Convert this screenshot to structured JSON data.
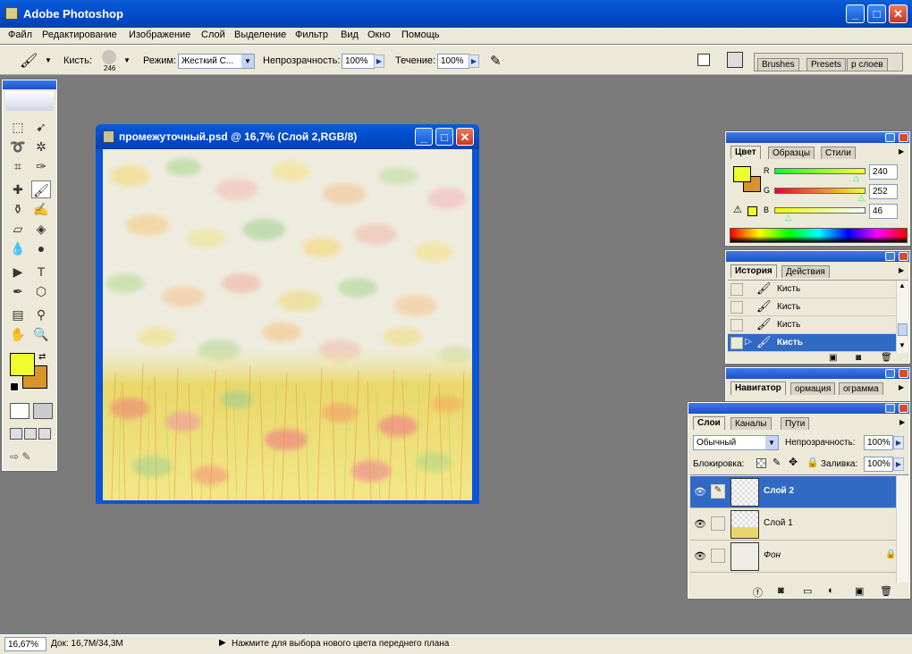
{
  "app": {
    "title": "Adobe Photoshop"
  },
  "menu": [
    "Файл",
    "Редактирование",
    "Изображение",
    "Слой",
    "Выделение",
    "Фильтр",
    "Вид",
    "Окно",
    "Помощь"
  ],
  "options": {
    "brush_label": "Кисть:",
    "brush_size": "246",
    "mode_label": "Режим:",
    "mode_value": "Жесткий С...",
    "opacity_label": "Непрозрачность:",
    "opacity_value": "100%",
    "flow_label": "Течение:",
    "flow_value": "100%",
    "wells": [
      "Brushes",
      "Presets",
      "р слоев"
    ]
  },
  "document": {
    "title": "промежуточный.psd @ 16,7% (Слой 2,RGB/8)"
  },
  "color_panel": {
    "tabs": [
      "Цвет",
      "Образцы",
      "Стили"
    ],
    "r_label": "R",
    "g_label": "G",
    "b_label": "B",
    "r": "240",
    "g": "252",
    "b": "46",
    "foreground": "#f0fc2e",
    "background": "#d7942b"
  },
  "history_panel": {
    "tabs": [
      "История",
      "Действия"
    ],
    "items": [
      "Кисть",
      "Кисть",
      "Кисть",
      "Кисть"
    ]
  },
  "navigator_panel": {
    "tabs": [
      "Навигатор",
      "ормация",
      "ограмма"
    ]
  },
  "layers_panel": {
    "tabs": [
      "Слои",
      "Каналы",
      "Пути"
    ],
    "blend_mode": "Обычный",
    "opacity_label": "Непрозрачность:",
    "opacity_value": "100%",
    "lock_label": "Блокировка:",
    "fill_label": "Заливка:",
    "fill_value": "100%",
    "layers": [
      "Слой 2",
      "Слой 1",
      "Фон"
    ]
  },
  "status": {
    "zoom": "16,67%",
    "doc_info": "Док: 16,7M/34,3M",
    "hint": "Нажмите для выбора нового цвета переднего плана"
  },
  "colors": {
    "selection": "#316ac5",
    "panel_bg": "#ece9d8",
    "workspace": "#7b7b7b"
  }
}
